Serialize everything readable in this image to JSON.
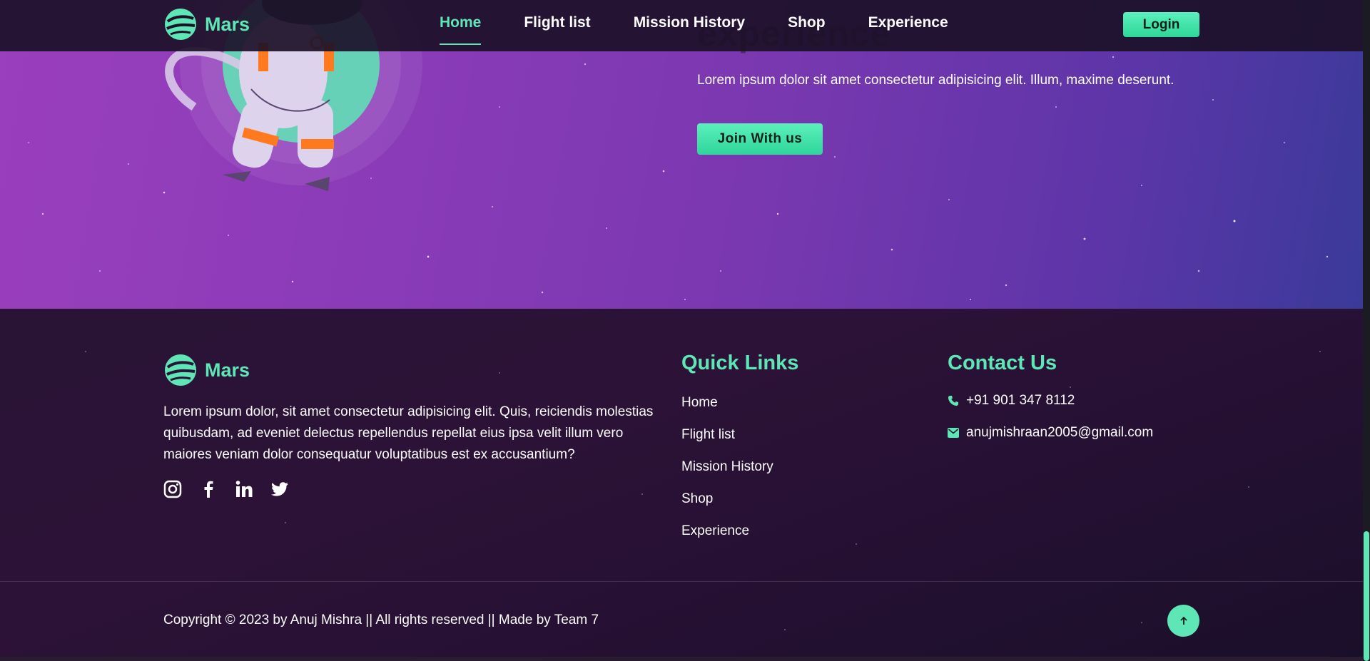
{
  "nav": {
    "brand": "Mars",
    "links": [
      {
        "label": "Home",
        "active": true
      },
      {
        "label": "Flight list",
        "active": false
      },
      {
        "label": "Mission History",
        "active": false
      },
      {
        "label": "Shop",
        "active": false
      },
      {
        "label": "Experience",
        "active": false
      }
    ],
    "login_label": "Login"
  },
  "hero": {
    "title": "experience",
    "text": "Lorem ipsum dolor sit amet consectetur adipisicing elit. Illum, maxime deserunt.",
    "join_label": "Join With us"
  },
  "footer": {
    "brand": "Mars",
    "description": "Lorem ipsum dolor, sit amet consectetur adipisicing elit. Quis, reiciendis molestias quibusdam, ad eveniet delectus repellendus repellat eius ipsa velit illum vero maiores veniam dolor consequatur voluptatibus est ex accusantium?",
    "socials": [
      "instagram-icon",
      "facebook-icon",
      "linkedin-icon",
      "twitter-icon"
    ],
    "quick_links_title": "Quick Links",
    "quick_links": [
      "Home",
      "Flight list",
      "Mission History",
      "Shop",
      "Experience"
    ],
    "contact_title": "Contact Us",
    "phone": "+91 901 347 8112",
    "email": "anujmishraan2005@gmail.com",
    "copyright": "Copyright © 2023 by Anuj Mishra || All rights reserved || Made by Team 7"
  },
  "colors": {
    "accent": "#5ee6b6",
    "hero_start": "#9a3fbd",
    "hero_end": "#3a3a9a",
    "footer_bg": "#2a1436"
  }
}
